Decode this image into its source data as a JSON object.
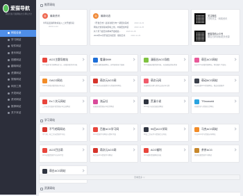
{
  "sidebar": {
    "logo_text": "爱猫导航",
    "logo_sub": "网址导航-导航网站大全-网址大全",
    "items": [
      {
        "label": "网站合适",
        "active": true
      },
      {
        "label": "学习网站",
        "active": false
      },
      {
        "label": "软件网站",
        "active": false
      },
      {
        "label": "音乐网站",
        "active": false
      },
      {
        "label": "视频网站",
        "active": false
      },
      {
        "label": "趣味网站",
        "active": false
      },
      {
        "label": "资源网站",
        "active": false
      },
      {
        "label": "搜索网站",
        "active": false
      },
      {
        "label": "网页工具",
        "active": false
      },
      {
        "label": "开发网站",
        "active": false
      },
      {
        "label": "资讯网站",
        "active": false
      },
      {
        "label": "推荐网站",
        "active": false
      },
      {
        "label": "关于本站",
        "active": false
      }
    ]
  },
  "top": {
    "section_label": "推荐网站",
    "news_title": "最新资讯",
    "news_line": "半年后爱猫导航将进入二次开发阶段",
    "news_date": "2023.11.22",
    "notice_title": "最新动态",
    "notice_lines": [
      {
        "text": "《开发日志》最新功能分布一期更新完成",
        "date": "2023.11.23"
      },
      {
        "text": "网站计划新版块即将上线，内容更加丰富",
        "date": "2023.11.25"
      },
      {
        "text": "共十月飞起走向样本开发成绩...",
        "date": "2023.11.28"
      },
      {
        "text": "2023年10月开发日志结束 · 规划日志",
        "date": "2023.11.23"
      }
    ],
    "qr1_title": "关注微信",
    "qr1_sub": "扫码关注 · 网络资讯",
    "qr2_title": "爱猫导航公众号",
    "qr2_sub": "微信扫码领取更多资源"
  },
  "section1": {
    "cards": [
      {
        "title": "ACG主题导航站",
        "desc": "ACG爱好者主题网站汇总，动漫游戏资讯导航",
        "color": "#e8453c"
      },
      {
        "title": "看漫DMH",
        "desc": "免费在线看漫画网站，实时更新热门漫画",
        "color": "#1e6fd8"
      },
      {
        "title": "漫画谷ACG导航",
        "desc": "ACG漫画动漫资源导航，在线收集优质资源",
        "color": "#7fc241"
      },
      {
        "title": "萌豆ACG网站",
        "desc": "萌系ACG动漫资源网站，壁纸图片下载站",
        "color": "#e85a9a"
      },
      {
        "title": "GACG网站",
        "desc": "GACG游戏动漫资源分享站点",
        "color": "#f28c28"
      },
      {
        "title": "萌次元ACG网",
        "desc": "ACG萌次元动漫资讯与资源共享网站",
        "color": "#d6342b"
      },
      {
        "title": "萌次元网",
        "desc": "动漫壁纸头像与资讯交流分享社区",
        "color": "#f05b6b"
      },
      {
        "title": "萌动ACG网站",
        "desc": "萌动动漫ACG资源网站，精品动漫推荐",
        "color": "#3a3f4a"
      },
      {
        "title": "Ex二次元网站",
        "desc": "二次元文化爱好者资源分享交流网站",
        "color": "#e8453c"
      },
      {
        "title": "流云社",
        "desc": "动漫游戏资源分享社区网站",
        "color": "#d94a9a"
      },
      {
        "title": "荒漫小说",
        "desc": "ACG轻小说在线阅读网站",
        "color": "#2f3440"
      },
      {
        "title": "TSnoworld",
        "desc": "动漫资讯与资源综合网站",
        "color": "#2aa3df"
      }
    ]
  },
  "section2": {
    "label": "学习网站",
    "cards": [
      {
        "title": "不气吧萌网站",
        "desc": "不气吧，萌二次元资源学习站",
        "color": "#d6342b"
      },
      {
        "title": "百度ACG学习网",
        "desc": "ACG资源学习网站与资料下载",
        "color": "#e8453c"
      },
      {
        "title": "90后ACG学网",
        "desc": "90后二次元学习资源汇总导航",
        "color": "#2f3440"
      },
      {
        "title": "马克ACG网站",
        "desc": "马克ACG学习资源分享网站",
        "color": "#f28c28"
      },
      {
        "title": "ACG巴比萌",
        "desc": "ACG动漫资源学习分享平台",
        "color": "#e8453c"
      },
      {
        "title": "萌次元ACG网",
        "desc": "萌次元ACG资源学习网站",
        "color": "#d6342b"
      },
      {
        "title": "ACG福利",
        "desc": "ACG福利资源网站导航",
        "color": "#e8453c"
      },
      {
        "title": "茶茶ACG",
        "desc": "茶茶动漫资源学习网站",
        "color": "#c7882c"
      },
      {
        "title": "萌白ACG网站",
        "desc": "萌白二次元资源学习站点",
        "color": "#2f3440"
      }
    ]
  },
  "more_button": "查看更多 ∨",
  "section3": {
    "label": "资源网站"
  }
}
